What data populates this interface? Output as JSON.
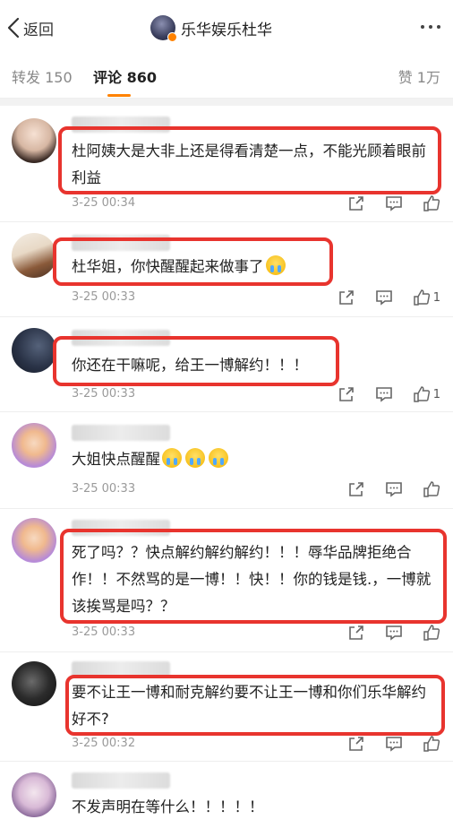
{
  "nav": {
    "back_label": "返回",
    "title": "乐华娱乐杜华"
  },
  "tabs": {
    "repost": "转发 150",
    "comments": "评论 860",
    "likes": "赞 1万"
  },
  "comments": [
    {
      "name_tail": "",
      "text": "杜阿姨大是大非上还是得看清楚一点，不能光顾着眼前利益",
      "time": "3-25 00:34",
      "likes": "",
      "highlighted": true
    },
    {
      "name_tail": "",
      "text": "杜华姐，你快醒醒起来做事了",
      "time": "3-25 00:33",
      "likes": "1",
      "highlighted": true
    },
    {
      "name_tail": "",
      "text": "你还在干嘛呢，给王一博解约！！！",
      "time": "3-25 00:33",
      "likes": "1",
      "highlighted": true
    },
    {
      "name_tail": "",
      "text": "大姐快点醒醒",
      "time": "3-25 00:33",
      "likes": "",
      "highlighted": false
    },
    {
      "name_tail": "",
      "text": "死了吗？？快点解约解约解约！！！辱华品牌拒绝合作！！不然骂的是一博！！快！！你的钱是钱.，一博就该挨骂是吗？？",
      "time": "3-25 00:33",
      "likes": "",
      "highlighted": true
    },
    {
      "name_tail": "",
      "text": "要不让王一博和耐克解约要不让王一博和你们乐华解约好不?",
      "time": "3-25 00:32",
      "likes": "",
      "highlighted": true
    },
    {
      "name_tail": "",
      "text": "不发声明在等什么！！！！！",
      "time": "",
      "likes": "",
      "highlighted": false
    }
  ],
  "icons": {
    "back": "chevron-left-icon",
    "more": "more-dots-icon",
    "share": "share-icon",
    "reply": "comment-icon",
    "like": "thumbs-up-icon"
  },
  "colors": {
    "accent": "#ff8200",
    "highlight_box": "#e8342e"
  }
}
